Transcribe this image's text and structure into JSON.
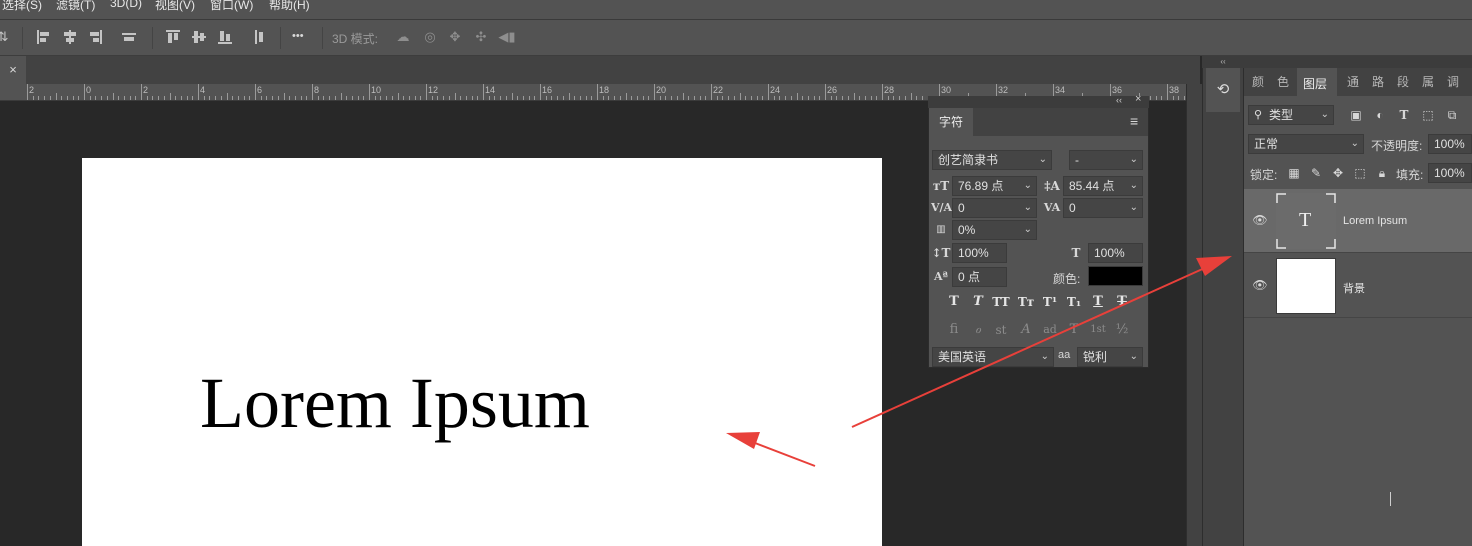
{
  "menu": {
    "items": [
      {
        "label": "选择(S)"
      },
      {
        "label": "滤镜(T)"
      },
      {
        "label": "3D(D)"
      },
      {
        "label": "视图(V)"
      },
      {
        "label": "窗口(W)"
      },
      {
        "label": "帮助(H)"
      }
    ]
  },
  "options_bar": {
    "mode_3d_label": "3D 模式:",
    "more_glyph": "•••"
  },
  "document": {
    "close_glyph": "×",
    "canvas_text": "Lorem Ipsum"
  },
  "ruler": {
    "labels": [
      "2",
      "0",
      "2",
      "4",
      "6",
      "8",
      "10",
      "12",
      "14",
      "16",
      "18",
      "20",
      "22",
      "24",
      "26",
      "28",
      "30",
      "32",
      "34",
      "36",
      "38"
    ]
  },
  "dock": {
    "collapse_glyph": "‹‹"
  },
  "layers_panel": {
    "tabs": [
      {
        "label": "颜"
      },
      {
        "label": "色"
      },
      {
        "label": "图层"
      },
      {
        "label": "通"
      },
      {
        "label": "路"
      },
      {
        "label": "段"
      },
      {
        "label": "属"
      },
      {
        "label": "调"
      }
    ],
    "filter_type": "类型",
    "blend_mode": "正常",
    "opacity_label": "不透明度:",
    "opacity_value": "100%",
    "lock_label": "锁定:",
    "fill_label": "填充:",
    "fill_value": "100%",
    "layers": [
      {
        "name": "Lorem Ipsum",
        "kind": "text",
        "thumb_glyph": "T"
      },
      {
        "name": "背景",
        "kind": "background"
      }
    ]
  },
  "character_panel": {
    "tab_label": "字符",
    "font_family": "创艺简隶书",
    "font_style": "-",
    "font_size": "76.89 点",
    "leading": "85.44 点",
    "kerning": "0",
    "tracking": "0",
    "tsume": "0%",
    "vertical_scale": "100%",
    "horizontal_scale": "100%",
    "baseline_shift": "0 点",
    "color_label": "颜色:",
    "color_value": "#000000",
    "language": "美国英语",
    "antialias_icon_text": "aa",
    "antialias": "锐利",
    "style_buttons": [
      "T",
      "T",
      "TT",
      "Tт",
      "T¹",
      "T₁",
      "T",
      "T"
    ],
    "opentype_buttons": [
      "fi",
      "ℴ",
      "st",
      "A",
      "ad",
      "T",
      "1st",
      "½"
    ],
    "panel_collapse_glyph": "‹‹",
    "panel_close_glyph": "×",
    "menu_glyph": "≡"
  },
  "colors": {
    "annotation_arrow": "#e8403a",
    "panel_bg": "#535353",
    "workspace_bg": "#282828"
  }
}
